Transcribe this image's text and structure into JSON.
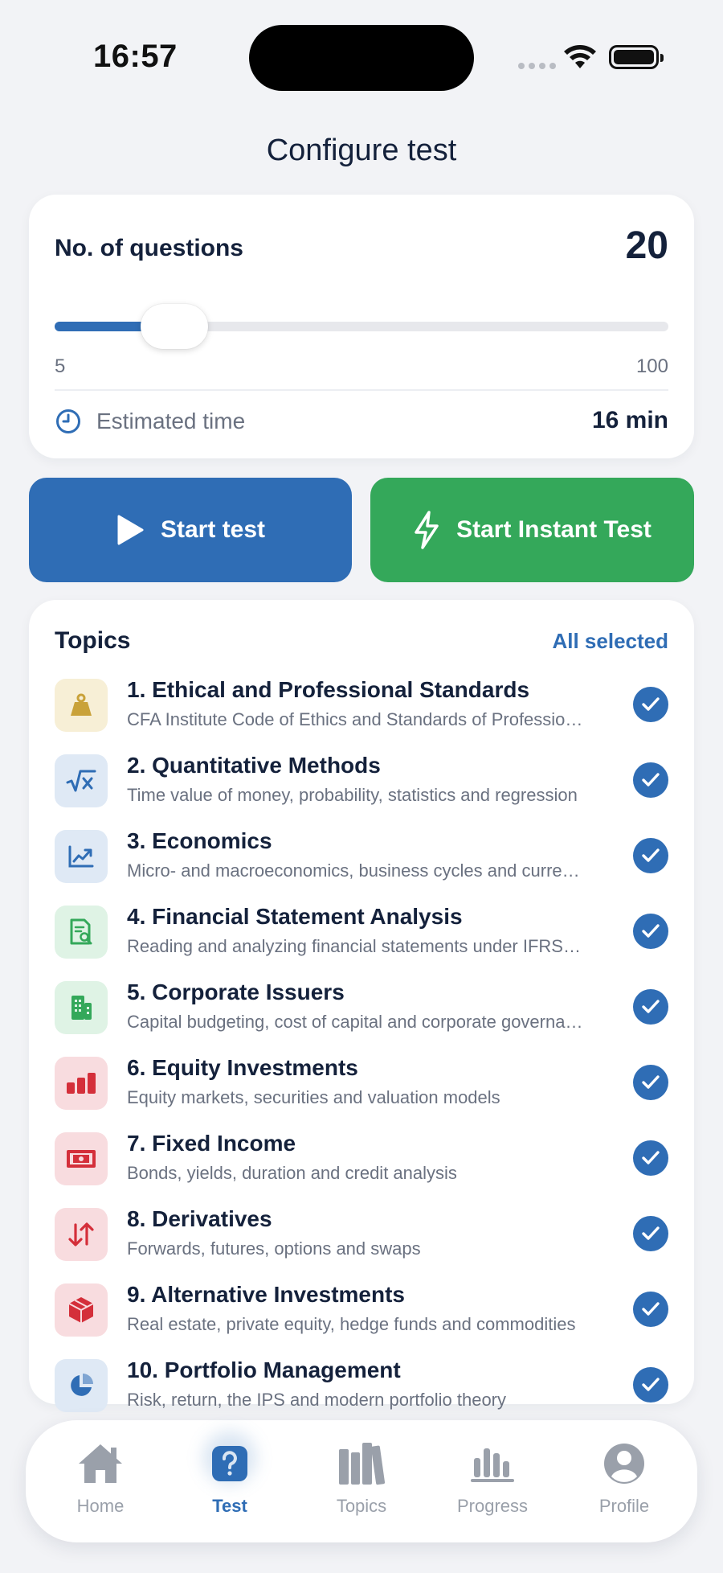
{
  "status_bar": {
    "time": "16:57"
  },
  "page_title": "Configure test",
  "questions": {
    "label": "No. of questions",
    "value": "20",
    "min": "5",
    "max": "100",
    "slider_fraction": 0.158,
    "estimated_label": "Estimated time",
    "estimated_value": "16 min"
  },
  "actions": {
    "start_label": "Start test",
    "instant_label": "Start Instant Test"
  },
  "topics": {
    "title": "Topics",
    "selection_status": "All selected",
    "items": [
      {
        "name": "1. Ethical and Professional Standards",
        "desc": "CFA Institute Code of Ethics and Standards of Professional Conduct",
        "icon": "weight-icon",
        "color": "#c9a23a",
        "bg": "#f7efd6",
        "checked": true
      },
      {
        "name": "2. Quantitative Methods",
        "desc": "Time value of money, probability, statistics and regression",
        "icon": "sqrt-icon",
        "color": "#2f6db5",
        "bg": "#dfe9f5",
        "checked": true
      },
      {
        "name": "3. Economics",
        "desc": "Micro- and macroeconomics, business cycles and currency",
        "icon": "chart-line-icon",
        "color": "#2f6db5",
        "bg": "#dfe9f5",
        "checked": true
      },
      {
        "name": "4. Financial Statement Analysis",
        "desc": "Reading and analyzing financial statements under IFRS and GAAP",
        "icon": "document-search-icon",
        "color": "#34a85a",
        "bg": "#dff3e5",
        "checked": true
      },
      {
        "name": "5. Corporate Issuers",
        "desc": "Capital budgeting, cost of capital and corporate governance",
        "icon": "building-icon",
        "color": "#34a85a",
        "bg": "#dff3e5",
        "checked": true
      },
      {
        "name": "6. Equity Investments",
        "desc": "Equity markets, securities and valuation models",
        "icon": "bar-chart-icon",
        "color": "#d42f3a",
        "bg": "#f8dcdf",
        "checked": true
      },
      {
        "name": "7. Fixed Income",
        "desc": "Bonds, yields, duration and credit analysis",
        "icon": "banknote-icon",
        "color": "#d42f3a",
        "bg": "#f8dcdf",
        "checked": true
      },
      {
        "name": "8. Derivatives",
        "desc": "Forwards, futures, options and swaps",
        "icon": "arrows-updown-icon",
        "color": "#d42f3a",
        "bg": "#f8dcdf",
        "checked": true
      },
      {
        "name": "9. Alternative Investments",
        "desc": "Real estate, private equity, hedge funds and commodities",
        "icon": "cube-icon",
        "color": "#d42f3a",
        "bg": "#f8dcdf",
        "checked": true
      },
      {
        "name": "10. Portfolio Management",
        "desc": "Risk, return, the IPS and modern portfolio theory",
        "icon": "pie-chart-icon",
        "color": "#2f6db5",
        "bg": "#dfe9f5",
        "checked": true
      }
    ]
  },
  "tab_bar": {
    "tabs": [
      {
        "label": "Home",
        "icon": "house-icon",
        "active": false
      },
      {
        "label": "Test",
        "icon": "question-icon",
        "active": true
      },
      {
        "label": "Topics",
        "icon": "books-icon",
        "active": false
      },
      {
        "label": "Progress",
        "icon": "bars-icon",
        "active": false
      },
      {
        "label": "Profile",
        "icon": "person-icon",
        "active": false
      }
    ]
  },
  "colors": {
    "accent": "#2f6db5",
    "success": "#34a85a",
    "text": "#14213b",
    "muted": "#6a7180"
  }
}
